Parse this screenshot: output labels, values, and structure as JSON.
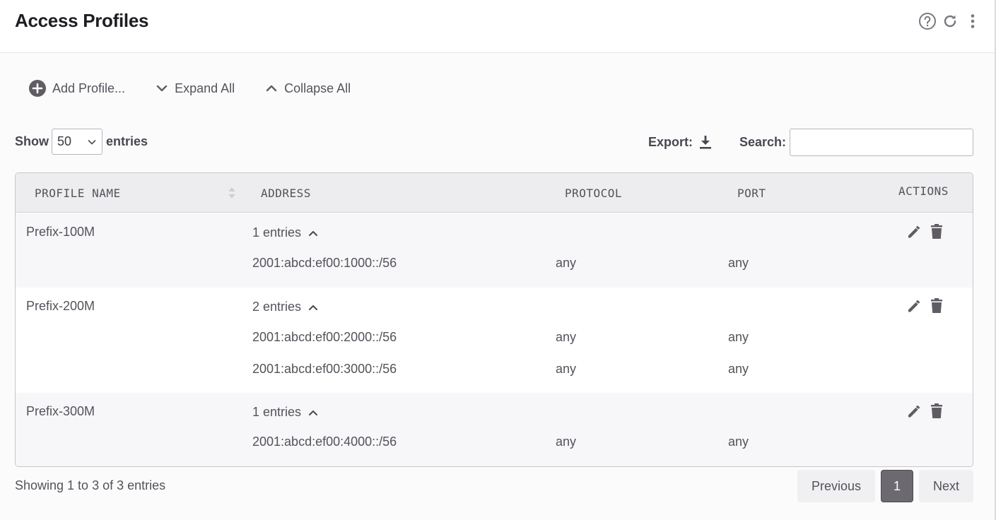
{
  "header": {
    "title": "Access Profiles",
    "icons": [
      "help-icon",
      "refresh-icon",
      "more-vert-icon"
    ]
  },
  "toolbar": {
    "add_label": "Add Profile...",
    "expand_label": "Expand All",
    "collapse_label": "Collapse All"
  },
  "length": {
    "show_label": "Show",
    "value": "50",
    "entries_label": "entries"
  },
  "export": {
    "label": "Export:"
  },
  "search": {
    "label": "Search:",
    "value": "",
    "placeholder": ""
  },
  "table": {
    "columns": [
      "PROFILE NAME",
      "ADDRESS",
      "PROTOCOL",
      "PORT",
      "ACTIONS"
    ],
    "rows": [
      {
        "name": "Prefix-100M",
        "count": "1 entries",
        "entries": [
          {
            "address": "2001:abcd:ef00:1000::/56",
            "protocol": "any",
            "port": "any"
          }
        ]
      },
      {
        "name": "Prefix-200M",
        "count": "2 entries",
        "entries": [
          {
            "address": "2001:abcd:ef00:2000::/56",
            "protocol": "any",
            "port": "any"
          },
          {
            "address": "2001:abcd:ef00:3000::/56",
            "protocol": "any",
            "port": "any"
          }
        ]
      },
      {
        "name": "Prefix-300M",
        "count": "1 entries",
        "entries": [
          {
            "address": "2001:abcd:ef00:4000::/56",
            "protocol": "any",
            "port": "any"
          }
        ]
      }
    ]
  },
  "footer": {
    "info": "Showing 1 to 3 of 3 entries",
    "previous": "Previous",
    "page": "1",
    "next": "Next"
  },
  "colors": {
    "accent": "#6c6970",
    "text": "#55525a",
    "header_bg": "#edecef"
  }
}
